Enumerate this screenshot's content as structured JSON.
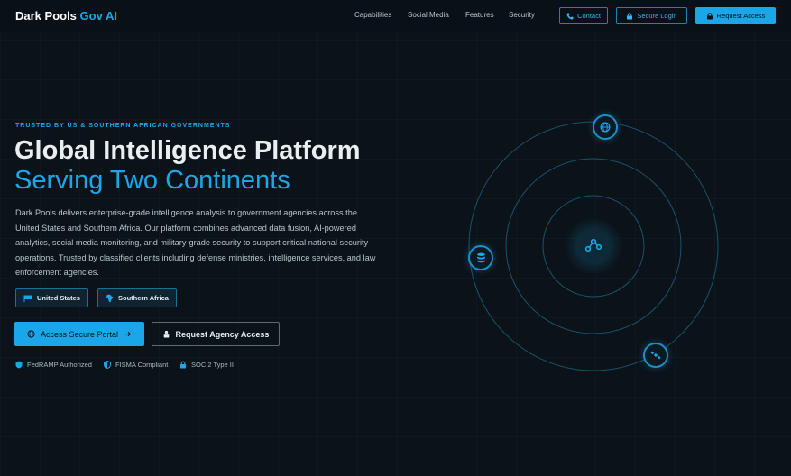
{
  "brand": {
    "name": "Dark Pools",
    "accent": "Gov AI"
  },
  "nav": [
    "Capabilities",
    "Social Media",
    "Features",
    "Security"
  ],
  "header_buttons": {
    "contact": "Contact",
    "login": "Secure Login",
    "request": "Request Access"
  },
  "hero": {
    "eyebrow": "TRUSTED BY US & SOUTHERN AFRICAN GOVERNMENTS",
    "title_line1": "Global Intelligence Platform",
    "title_line2": "Serving Two Continents",
    "description": "Dark Pools delivers enterprise-grade intelligence analysis to government agencies across the United States and Southern Africa. Our platform combines advanced data fusion, AI-powered analytics, social media monitoring, and military-grade security to support critical national security operations. Trusted by classified clients including defense ministries, intelligence services, and law enforcement agencies."
  },
  "regions": [
    "United States",
    "Southern Africa"
  ],
  "cta": {
    "primary": "Access Secure Portal",
    "secondary": "Request Agency Access"
  },
  "compliance": [
    "FedRAMP Authorized",
    "FISMA Compliant",
    "SOC 2 Type II"
  ],
  "colors": {
    "accent": "#1aa6e8",
    "background": "#0b1319"
  },
  "icons": {
    "contact": "phone-icon",
    "login": "lock-icon",
    "request": "lock-icon",
    "us": "flag-icon",
    "africa": "africa-icon",
    "primary": "globe-icon",
    "secondary": "user-lock-icon",
    "fedramp": "shield-icon",
    "fisma": "shield-half-icon",
    "soc": "lock-icon",
    "orbit_center": "network-icon",
    "orbit_top": "globe-icon",
    "orbit_left": "database-icon",
    "orbit_bottom": "satellite-icon"
  }
}
